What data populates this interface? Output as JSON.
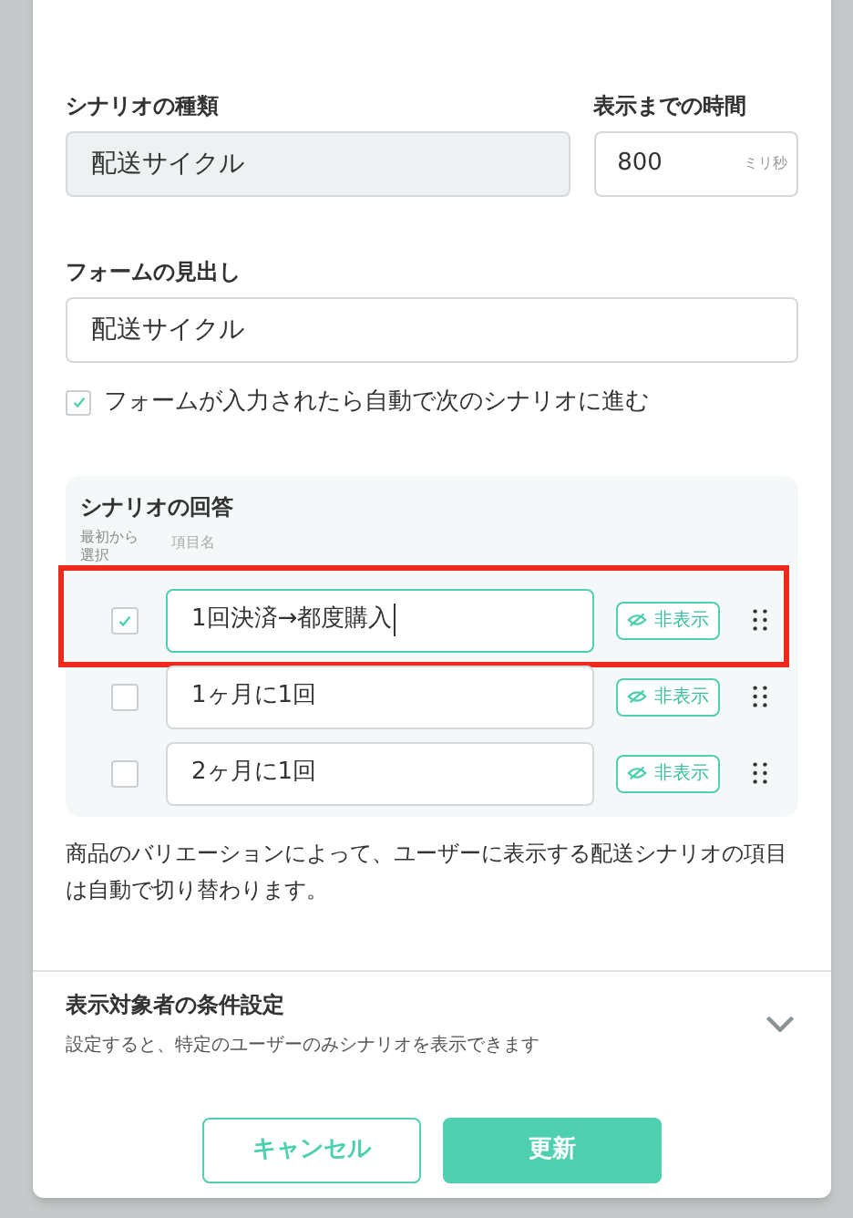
{
  "scenario_type": {
    "label": "シナリオの種類",
    "value": "配送サイクル",
    "disabled": true
  },
  "delay": {
    "label": "表示までの時間",
    "value": "800",
    "unit": "ミリ秒"
  },
  "form_heading": {
    "label": "フォームの見出し",
    "value": "配送サイクル"
  },
  "auto_advance": {
    "label": "フォームが入力されたら自動で次のシナリオに進む",
    "checked": true
  },
  "answers": {
    "title": "シナリオの回答",
    "column_1": "最初から選択",
    "column_2": "項目名",
    "rows": [
      {
        "name": "1回決済→都度購入",
        "checked": true,
        "focused": true,
        "highlighted": true,
        "hide_label": "非表示"
      },
      {
        "name": "1ヶ月に1回",
        "checked": false,
        "focused": false,
        "highlighted": false,
        "hide_label": "非表示"
      },
      {
        "name": "2ヶ月に1回",
        "checked": false,
        "focused": false,
        "highlighted": false,
        "hide_label": "非表示"
      }
    ]
  },
  "note": "商品のバリエーションによって、ユーザーに表示する配送シナリオの項目は自動で切り替わります。",
  "audience": {
    "title": "表示対象者の条件設定",
    "description": "設定すると、特定のユーザーのみシナリオを表示できます",
    "expanded": false
  },
  "buttons": {
    "cancel": "キャンセル",
    "submit": "更新"
  }
}
